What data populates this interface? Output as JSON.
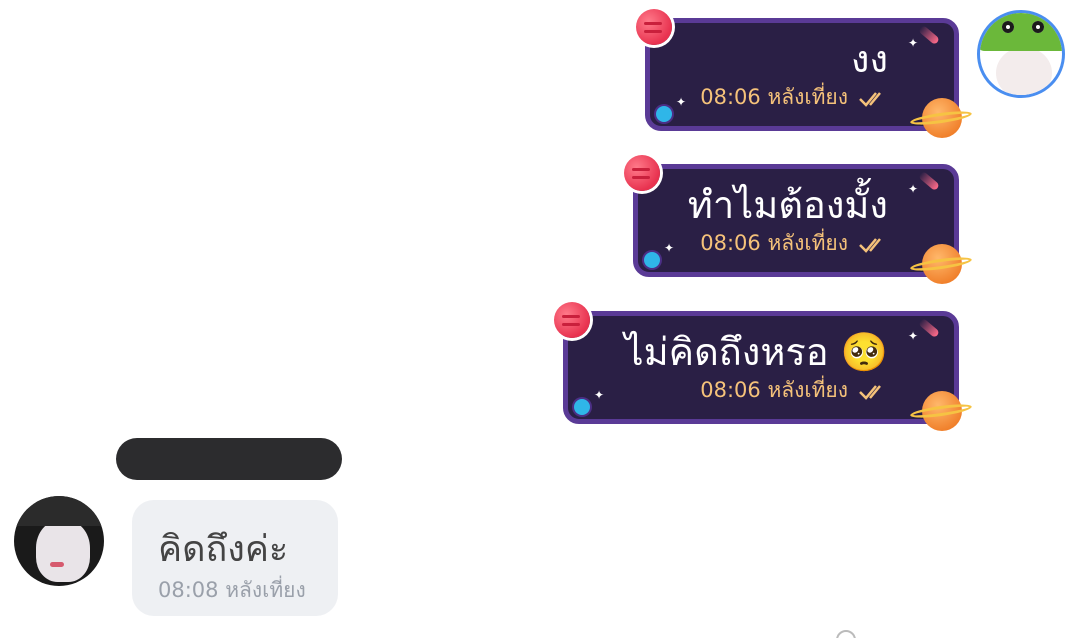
{
  "messages_out": [
    {
      "text": "งง",
      "time": "08:06 หลังเที่ยง"
    },
    {
      "text": "ทำไมต้องมั้ง",
      "time": "08:06 หลังเที่ยง"
    },
    {
      "text": "ไม่คิดถึงหรอ 🥺",
      "time": "08:06 หลังเที่ยง"
    }
  ],
  "message_in": {
    "sender_name": "",
    "text": "คิดถึงค่ะ",
    "time": "08:08 หลังเที่ยง"
  },
  "icons": {
    "read_receipt": "double-check-icon",
    "my_avatar": "avatar-dino-hat",
    "other_avatar": "avatar-contact"
  },
  "colors": {
    "bubble_out_bg": "#2a1f45",
    "bubble_out_border": "#5a3a96",
    "time_out": "#f5c27a",
    "bubble_in_bg": "#eef0f3",
    "time_in": "#9aa0aa"
  }
}
